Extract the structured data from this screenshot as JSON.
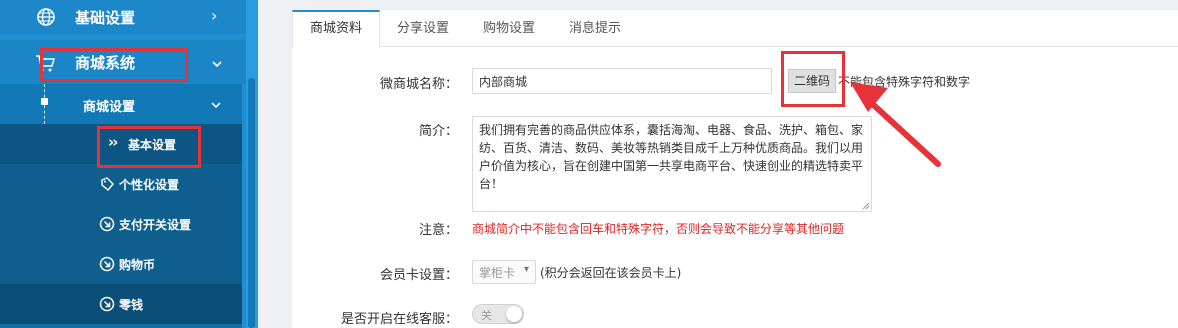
{
  "sidebar": {
    "top_item_label": "基础设置",
    "shop_system_label": "商城系统",
    "sub_group_label": "商城设置",
    "items": [
      {
        "label": "基本设置",
        "icon": "double-chevron-right-icon"
      },
      {
        "label": "个性化设置",
        "icon": "tag-icon"
      },
      {
        "label": "支付开关设置",
        "icon": "arrow-circle-icon"
      },
      {
        "label": "购物币",
        "icon": "arrow-circle-icon"
      },
      {
        "label": "零钱",
        "icon": "arrow-circle-icon"
      }
    ]
  },
  "tabs": [
    {
      "label": "商城资料",
      "active": true
    },
    {
      "label": "分享设置",
      "active": false
    },
    {
      "label": "购物设置",
      "active": false
    },
    {
      "label": "消息提示",
      "active": false
    }
  ],
  "form": {
    "name_label": "微商城名称：",
    "name_value": "内部商城",
    "qr_button": "二维码",
    "name_hint": "不能包含特殊字符和数字",
    "intro_label": "简介：",
    "intro_value": "我们拥有完善的商品供应体系，囊括海淘、电器、食品、洗护、箱包、家纺、百货、清洁、数码、美妆等热销类目成千上万种优质商品。我们以用户价值为核心，旨在创建中国第一共享电商平台、快速创业的精选特卖平台！",
    "note_label": "注意：",
    "note_text": "商城简介中不能包含回车和特殊字符，否则会导致不能分享等其他问题",
    "card_label": "会员卡设置：",
    "card_select": "掌柜卡",
    "card_hint": "(积分会返回在该会员卡上)",
    "service_label": "是否开启在线客服：",
    "service_toggle": "关"
  },
  "colors": {
    "sidebar_blue": "#1f8fd3",
    "annotation_red": "#e8323a",
    "warning_red": "#e02424",
    "tab_accent": "#1a8ed6"
  }
}
